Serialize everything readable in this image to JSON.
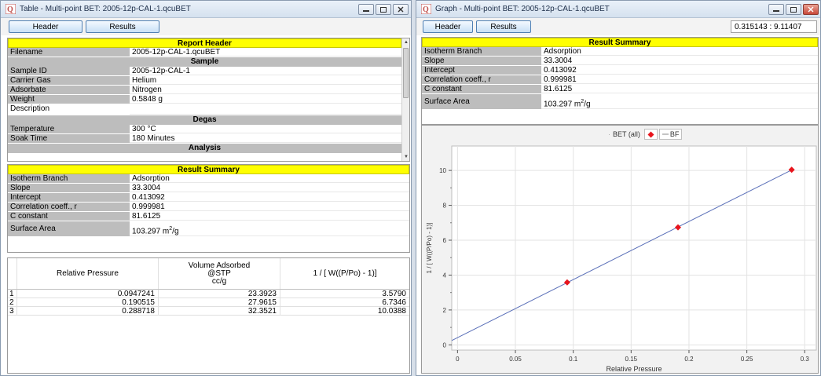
{
  "left_window": {
    "title": "Table - Multi-point BET: 2005-12p-CAL-1.qcuBET",
    "buttons": {
      "header": "Header",
      "results": "Results"
    },
    "report": {
      "title": "Report Header",
      "filename_label": "Filename",
      "filename_value": "2005-12p-CAL-1.qcuBET",
      "sample_title": "Sample",
      "sample_rows": [
        {
          "k": "Sample ID",
          "v": "2005-12p-CAL-1"
        },
        {
          "k": "Carrier Gas",
          "v": "Helium"
        },
        {
          "k": "Adsorbate",
          "v": "Nitrogen"
        },
        {
          "k": "Weight",
          "v": "0.5848 g"
        },
        {
          "k": "Description",
          "v": ""
        }
      ],
      "degas_title": "Degas",
      "degas_rows": [
        {
          "k": "Temperature",
          "v": "300 °C"
        },
        {
          "k": "Soak Time",
          "v": "180 Minutes"
        }
      ],
      "analysis_title": "Analysis"
    },
    "summary": {
      "title": "Result Summary",
      "rows": [
        {
          "k": "Isotherm Branch",
          "v": "Adsorption"
        },
        {
          "k": "Slope",
          "v": "33.3004"
        },
        {
          "k": "Intercept",
          "v": "0.413092"
        },
        {
          "k": "Correlation coeff., r",
          "v": "0.999981"
        },
        {
          "k": "C constant",
          "v": "81.6125"
        }
      ],
      "area_label": "Surface Area",
      "area_value": "103.297 m",
      "area_unit_sup": "2",
      "area_unit_tail": "/g"
    },
    "data_table": {
      "headers": {
        "rel": "Relative Pressure",
        "vol_1": "Volume Adsorbed",
        "vol_2": "@STP",
        "vol_3": "cc/g",
        "bet": "1 / [ W((P/Po) - 1)]"
      },
      "rows": [
        {
          "i": "1",
          "p": "0.0947241",
          "v": "23.3923",
          "b": "3.5790"
        },
        {
          "i": "2",
          "p": "0.190515",
          "v": "27.9615",
          "b": "6.7346"
        },
        {
          "i": "3",
          "p": "0.288718",
          "v": "32.3521",
          "b": "10.0388"
        }
      ]
    }
  },
  "right_window": {
    "title": "Graph - Multi-point BET: 2005-12p-CAL-1.qcuBET",
    "buttons": {
      "header": "Header",
      "results": "Results"
    },
    "coord_readout": "0.315143 : 9.11407",
    "summary": {
      "title": "Result Summary",
      "rows": [
        {
          "k": "Isotherm Branch",
          "v": "Adsorption"
        },
        {
          "k": "Slope",
          "v": "33.3004"
        },
        {
          "k": "Intercept",
          "v": "0.413092"
        },
        {
          "k": "Correlation coeff., r",
          "v": "0.999981"
        },
        {
          "k": "C constant",
          "v": "81.6125"
        }
      ],
      "area_label": "Surface Area",
      "area_value": "103.297 m",
      "area_unit_sup": "2",
      "area_unit_tail": "/g"
    },
    "legend": {
      "bet_all": "BET (all)",
      "bf": "BF"
    }
  },
  "colors": {
    "header_yellow": "#ffff00",
    "marker_red": "#e8141c",
    "fit_line": "#5a6fb8"
  },
  "chart_data": {
    "type": "scatter",
    "xlabel": "Relative Pressure",
    "ylabel": "1 / [ W((P/Po) - 1)]",
    "xlim": [
      -0.005,
      0.31
    ],
    "ylim": [
      -0.3,
      11.4
    ],
    "x_ticks": [
      "0",
      "0.05",
      "0.1",
      "0.15",
      "0.2",
      "0.25",
      "0.3"
    ],
    "y_ticks": [
      "0",
      "2",
      "4",
      "6",
      "8",
      "10"
    ],
    "grid": true,
    "legend_position": "top-center",
    "series": [
      {
        "name": "BET (all)",
        "points": [
          [
            0.0947241,
            3.579
          ],
          [
            0.190515,
            6.7346
          ],
          [
            0.288718,
            10.0388
          ]
        ]
      },
      {
        "name": "BF",
        "slope": 33.3004,
        "intercept": 0.413092
      }
    ]
  }
}
